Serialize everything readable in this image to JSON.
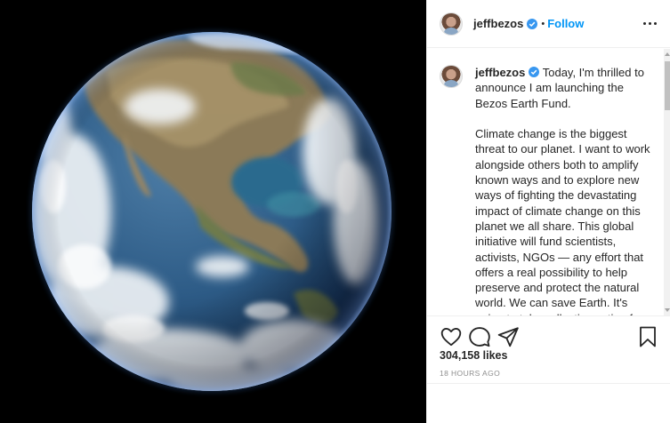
{
  "post": {
    "username": "jeffbezos",
    "dot": "•",
    "follow_label": "Follow",
    "caption_opening": "Today, I'm thrilled to announce I am launching the Bezos Earth Fund.",
    "caption_body": "Climate change is the biggest threat to our planet. I want to work alongside others both to amplify known ways and to explore new ways of fighting the devastating impact of climate change on this planet we all share. This global initiative will fund scientists, activists, NGOs — any effort that offers a real possibility to help preserve and protect the natural world. We can save Earth. It's going to take collective action from big companies, small companies, nation states, global organizations, and individuals.",
    "likes": "304,158 likes",
    "timestamp": "18 HOURS AGO"
  },
  "icons": {
    "verified": "verified-badge",
    "like": "heart-outline",
    "comment": "speech-bubble",
    "share": "paper-plane",
    "save": "bookmark-outline",
    "more": "three-dots"
  },
  "colors": {
    "accent": "#0095f6",
    "verified": "#3897f0",
    "text": "#262626",
    "muted": "#8e8e8e"
  }
}
